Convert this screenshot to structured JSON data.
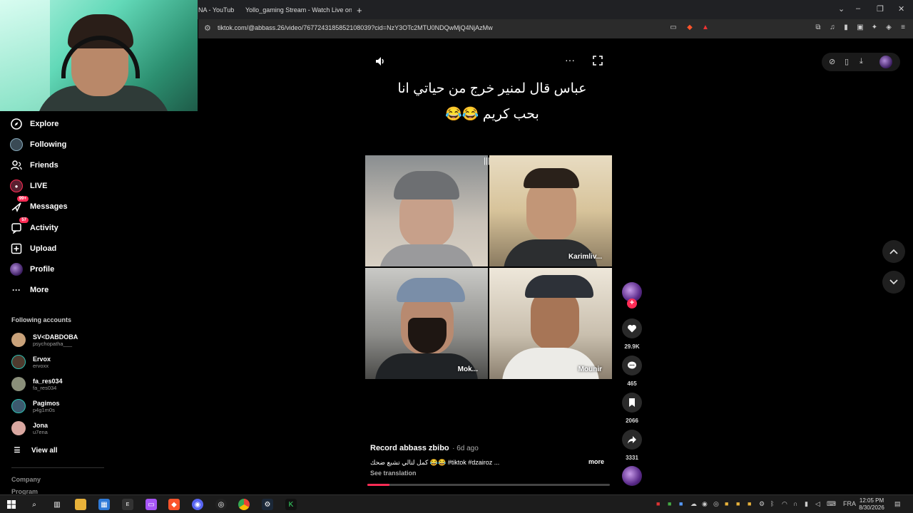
{
  "browser": {
    "tabs": [
      {
        "title": "NA - YouTube"
      },
      {
        "title": "Yollo_gaming Stream - Watch Live on"
      }
    ],
    "new_tab_label": "+",
    "url": "tiktok.com/@abbass.26/video/7677243185852108039?cid=NzY3OTc2MTU0NDQwMjQ4NjAzMw"
  },
  "sidebar": {
    "nav": [
      {
        "label": "Explore",
        "icon": "compass-icon"
      },
      {
        "label": "Following",
        "icon": "following-avatar-icon"
      },
      {
        "label": "Friends",
        "icon": "friends-icon"
      },
      {
        "label": "LIVE",
        "icon": "live-icon"
      },
      {
        "label": "Messages",
        "icon": "messages-icon",
        "badge": "99+"
      },
      {
        "label": "Activity",
        "icon": "activity-icon",
        "badge": "57"
      },
      {
        "label": "Upload",
        "icon": "upload-icon"
      },
      {
        "label": "Profile",
        "icon": "profile-avatar-icon"
      },
      {
        "label": "More",
        "icon": "more-dots-icon"
      }
    ],
    "following_title": "Following accounts",
    "accounts": [
      {
        "name": "SV<DABDOBA",
        "handle": "psychopatha___",
        "color": "#c9a27a"
      },
      {
        "name": "Ervox",
        "handle": "ervoxx",
        "color": "#4e3a2e"
      },
      {
        "name": "fa_res034",
        "handle": "fa_res034",
        "color": "#8a8f7a"
      },
      {
        "name": "Pagimos",
        "handle": "p4g1m0s",
        "color": "#3c5a6e"
      },
      {
        "name": "Jona",
        "handle": "u7ena",
        "color": "#d9a7a0"
      }
    ],
    "view_all": "View all",
    "footer": [
      "Company",
      "Program"
    ]
  },
  "video": {
    "caption_line1": "عباس قال لمنير خرج من حياتي انا",
    "caption_line2": "بحب كريم 😂😂",
    "participants": [
      "Karimliv...",
      "Mok...",
      "Mounir"
    ],
    "author": "Record abbass zbibo",
    "date": "· 6d ago",
    "description": "كمل لتالي تشبع ضحك 😂😂 #tiktok #dzairoz ...",
    "more": "more",
    "see_translation": "See translation",
    "progress": 0.09
  },
  "actions": {
    "likes": "29.9K",
    "comments": "465",
    "saves": "2066",
    "shares": "3331"
  },
  "taskbar": {
    "lang": "FRA",
    "time": "12:05 PM",
    "date": "8/30/2026"
  },
  "colors": {
    "accent": "#fe2c55",
    "background": "#000000"
  }
}
